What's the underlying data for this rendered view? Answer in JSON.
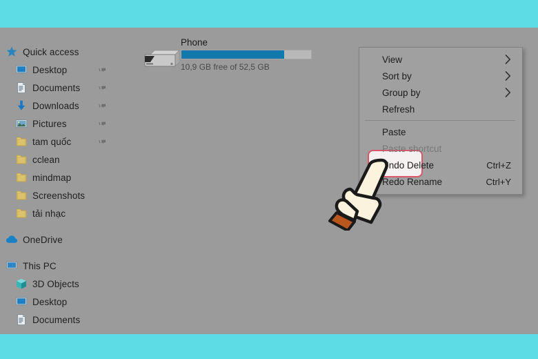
{
  "theme": {
    "frame_color": "#5ddce5",
    "window_bg": "#9b9b9b",
    "menu_bg": "#a0a0a0",
    "highlight_border": "#d9566b",
    "progress_fill": "#1378ac",
    "accent_blue": "#1a7fc1",
    "folder_yellow": "#e3c766"
  },
  "sidebar": {
    "items": [
      {
        "label": "Quick access",
        "icon": "star-icon",
        "pinned": false,
        "indent": 0
      },
      {
        "label": "Desktop",
        "icon": "monitor-icon",
        "pinned": true,
        "indent": 1
      },
      {
        "label": "Documents",
        "icon": "document-icon",
        "pinned": true,
        "indent": 1
      },
      {
        "label": "Downloads",
        "icon": "download-icon",
        "pinned": true,
        "indent": 1
      },
      {
        "label": "Pictures",
        "icon": "picture-icon",
        "pinned": true,
        "indent": 1
      },
      {
        "label": "tam quốc",
        "icon": "folder-icon",
        "pinned": true,
        "indent": 1
      },
      {
        "label": "cclean",
        "icon": "folder-icon",
        "pinned": false,
        "indent": 1
      },
      {
        "label": "mindmap",
        "icon": "folder-icon",
        "pinned": false,
        "indent": 1
      },
      {
        "label": "Screenshots",
        "icon": "folder-icon",
        "pinned": false,
        "indent": 1
      },
      {
        "label": "tải nhạc",
        "icon": "folder-icon",
        "pinned": false,
        "indent": 1
      },
      {
        "label": "OneDrive",
        "icon": "cloud-icon",
        "pinned": false,
        "indent": 0,
        "group_gap_before": true
      },
      {
        "label": "This PC",
        "icon": "computer-icon",
        "pinned": false,
        "indent": 0,
        "group_gap_before": true
      },
      {
        "label": "3D Objects",
        "icon": "cube-icon",
        "pinned": false,
        "indent": 1
      },
      {
        "label": "Desktop",
        "icon": "monitor-icon",
        "pinned": false,
        "indent": 1
      },
      {
        "label": "Documents",
        "icon": "document-icon",
        "pinned": false,
        "indent": 1
      }
    ]
  },
  "content": {
    "drive": {
      "name": "Phone",
      "capacity_text": "10,9 GB free of 52,5 GB",
      "free_gb": 10.9,
      "total_gb": 52.5,
      "used_percent": 79,
      "icon": "portable-device-icon"
    }
  },
  "context_menu": {
    "items": [
      {
        "label": "View",
        "type": "submenu",
        "accel": "",
        "disabled": false,
        "highlighted": false
      },
      {
        "label": "Sort by",
        "type": "submenu",
        "accel": "",
        "disabled": false,
        "highlighted": false
      },
      {
        "label": "Group by",
        "type": "submenu",
        "accel": "",
        "disabled": false,
        "highlighted": false
      },
      {
        "label": "Refresh",
        "type": "item",
        "accel": "",
        "disabled": false,
        "highlighted": false
      },
      {
        "label": "Paste",
        "type": "item",
        "accel": "",
        "disabled": false,
        "highlighted": true
      },
      {
        "label": "Paste shortcut",
        "type": "item",
        "accel": "",
        "disabled": true,
        "highlighted": false
      },
      {
        "label": "Undo Delete",
        "type": "item",
        "accel": "Ctrl+Z",
        "disabled": false,
        "highlighted": false
      },
      {
        "label": "Redo Rename",
        "type": "item",
        "accel": "Ctrl+Y",
        "disabled": false,
        "highlighted": false
      }
    ],
    "separator_after_index": 3
  },
  "cursor": {
    "type": "pointing-hand-cursor",
    "target_label": "Paste"
  }
}
